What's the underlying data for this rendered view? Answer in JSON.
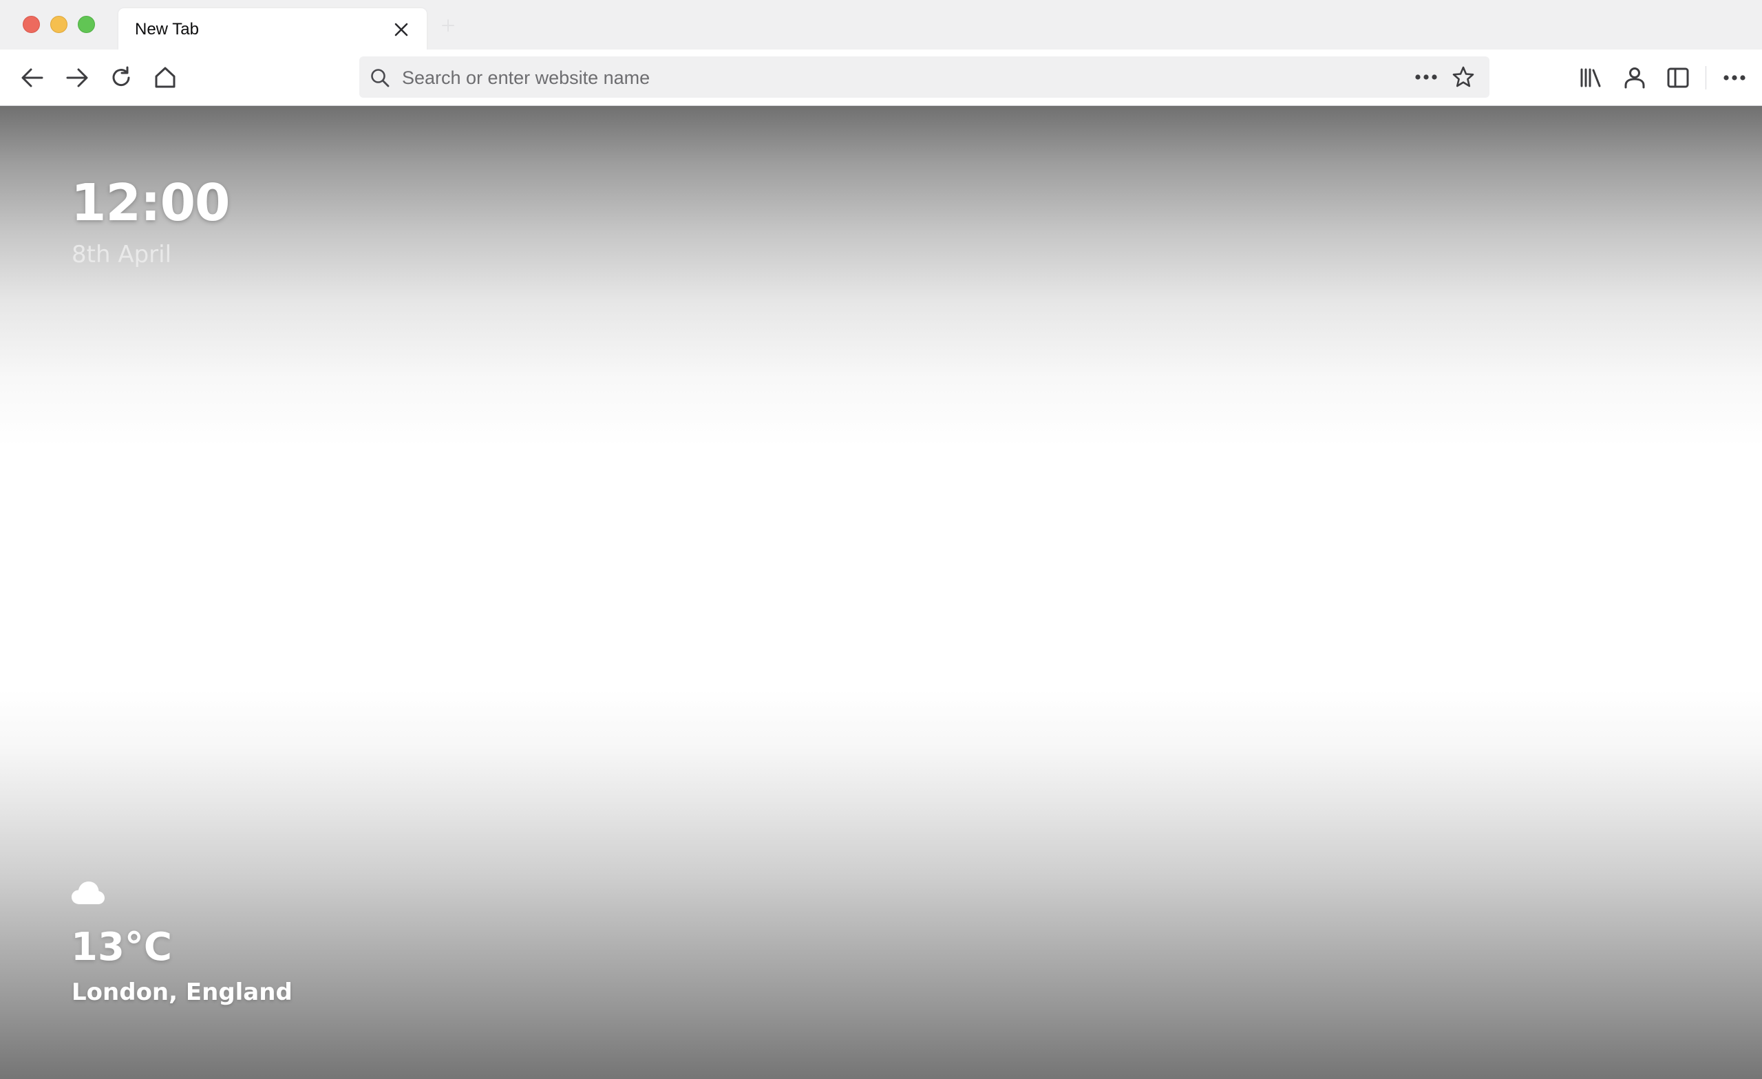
{
  "window": {
    "traffic_lights": [
      "close",
      "minimize",
      "zoom"
    ]
  },
  "tabs": [
    {
      "title": "New Tab",
      "active": true
    }
  ],
  "toolbar": {
    "nav_icons": [
      "back-arrow-icon",
      "forward-arrow-icon",
      "reload-icon",
      "home-icon"
    ],
    "right_icons": [
      "library-icon",
      "account-icon",
      "sidebar-icon",
      "menu-icon"
    ]
  },
  "urlbar": {
    "placeholder": "Search or enter website name",
    "value": ""
  },
  "new_tab_page": {
    "time": "12:00",
    "date": "8th April",
    "weather": {
      "icon": "cloud-icon",
      "temperature": "13°C",
      "location": "London, England"
    }
  },
  "colors": {
    "tabstrip_bg": "#f0f0f1",
    "urlbar_bg": "#f0f0f1",
    "icon_color": "#3d3d40",
    "traffic_red": "#ed6a5e",
    "traffic_yellow": "#f5bf4f",
    "traffic_green": "#61c554"
  }
}
